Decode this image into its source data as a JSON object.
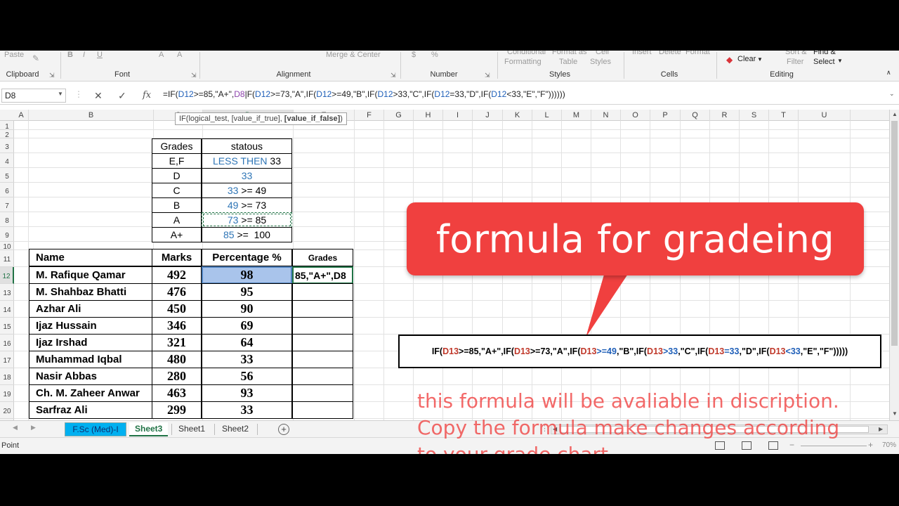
{
  "ribbon": {
    "group_labels": [
      "Clipboard",
      "Font",
      "Alignment",
      "Number",
      "Styles",
      "Cells",
      "Editing"
    ],
    "faded_items": [
      "Paste",
      "B",
      "I",
      "U",
      "A",
      "A",
      "Merge & Center",
      "$",
      "%",
      "Conditional",
      "Formatting",
      "Format as",
      "Table",
      "Cell",
      "Styles",
      "Insert",
      "Delete",
      "Format",
      "Sort &",
      "Filter",
      "Find &",
      "Select"
    ],
    "clear_label": "Clear"
  },
  "formula_bar": {
    "name_box": "D8",
    "cancel_icon": "close-icon",
    "enter_icon": "check-icon",
    "fx_label": "fx",
    "formula_segments": [
      {
        "t": "=IF(",
        "c": ""
      },
      {
        "t": "D12",
        "c": "ref-blue"
      },
      {
        "t": ">=85,\"A+\",",
        "c": ""
      },
      {
        "t": "D8",
        "c": "ref-purple"
      },
      {
        "t": "|F(",
        "c": ""
      },
      {
        "t": "D12",
        "c": "ref-blue"
      },
      {
        "t": ">=73,\"A\",IF(",
        "c": ""
      },
      {
        "t": "D12",
        "c": "ref-blue"
      },
      {
        "t": ">=49,\"B\",IF(",
        "c": ""
      },
      {
        "t": "D12",
        "c": "ref-blue"
      },
      {
        "t": ">33,\"C\",IF(",
        "c": ""
      },
      {
        "t": "D12",
        "c": "ref-blue"
      },
      {
        "t": "=33,\"D\",IF(",
        "c": ""
      },
      {
        "t": "D12",
        "c": "ref-blue"
      },
      {
        "t": "<33,\"E\",\"F\"))))))",
        "c": ""
      }
    ],
    "tooltip_prefix": "IF(logical_test, [value_if_true], ",
    "tooltip_bold": "[value_if_false]",
    "tooltip_suffix": ")"
  },
  "columns": [
    "A",
    "B",
    "C",
    "D",
    "E",
    "F",
    "G",
    "H",
    "I",
    "J",
    "K",
    "L",
    "M",
    "N",
    "O",
    "P",
    "Q",
    "R",
    "S",
    "T",
    "U"
  ],
  "rows": [
    "1",
    "2",
    "3",
    "4",
    "5",
    "6",
    "7",
    "8",
    "9",
    "10",
    "11",
    "12",
    "13",
    "14",
    "15",
    "16",
    "17",
    "18",
    "19",
    "20"
  ],
  "grade_chart": {
    "header_grade": "Grades",
    "header_status": "statous",
    "rows": [
      {
        "grade": "E,F",
        "status_blue": "LESS THEN",
        "status_black": " 33"
      },
      {
        "grade": "D",
        "status_blue": "33",
        "status_black": ""
      },
      {
        "grade": "C",
        "status_blue": "33",
        "status_black": " >= 49"
      },
      {
        "grade": "B",
        "status_blue": "49",
        "status_black": " >= 73"
      },
      {
        "grade": "A",
        "status_blue": "73",
        "status_black": " >= 85"
      },
      {
        "grade": "A+",
        "status_blue": "85",
        "status_black": " >=  100"
      }
    ]
  },
  "students": {
    "headers": [
      "Name",
      "Marks",
      "Percentage %",
      "Grades"
    ],
    "rows": [
      {
        "name": "M. Rafique Qamar",
        "marks": "492",
        "pct": "98",
        "grade": "85,\"A+\",D8"
      },
      {
        "name": "M. Shahbaz Bhatti",
        "marks": "476",
        "pct": "95",
        "grade": ""
      },
      {
        "name": "Azhar Ali",
        "marks": "450",
        "pct": "90",
        "grade": ""
      },
      {
        "name": "Ijaz Hussain",
        "marks": "346",
        "pct": "69",
        "grade": ""
      },
      {
        "name": "Ijaz Irshad",
        "marks": "321",
        "pct": "64",
        "grade": ""
      },
      {
        "name": "Muhammad Iqbal",
        "marks": "480",
        "pct": "33",
        "grade": ""
      },
      {
        "name": "Nasir Abbas",
        "marks": "280",
        "pct": "56",
        "grade": ""
      },
      {
        "name": "Ch. M. Zaheer Anwar",
        "marks": "463",
        "pct": "93",
        "grade": ""
      },
      {
        "name": "Sarfraz Ali",
        "marks": "299",
        "pct": "33",
        "grade": ""
      }
    ]
  },
  "callout": {
    "text": "formula for gradeing",
    "color": "#f0403f"
  },
  "formula_box": {
    "segments": [
      {
        "t": "IF(",
        "c": ""
      },
      {
        "t": "D13",
        "c": "ref-red"
      },
      {
        "t": ">=85,\"A+\",IF(",
        "c": ""
      },
      {
        "t": "D13",
        "c": "ref-red"
      },
      {
        "t": ">=73,\"A\",IF(",
        "c": ""
      },
      {
        "t": "D13",
        "c": "ref-red"
      },
      {
        "t": ">=49",
        "c": "ref-blue"
      },
      {
        "t": ",\"B\",IF(",
        "c": ""
      },
      {
        "t": "D13",
        "c": "ref-red"
      },
      {
        "t": ">33",
        "c": "ref-blue"
      },
      {
        "t": ",\"C\",IF(",
        "c": ""
      },
      {
        "t": "D13",
        "c": "ref-red"
      },
      {
        "t": "=33",
        "c": "ref-blue"
      },
      {
        "t": ",\"D\",IF(",
        "c": ""
      },
      {
        "t": "D13",
        "c": "ref-red"
      },
      {
        "t": "<33",
        "c": "ref-blue"
      },
      {
        "t": ",\"E\",\"F\")))))",
        "c": ""
      }
    ]
  },
  "note": "this formula will be avaliable in discription. Copy the formula make changes according to your grade chart",
  "sheet_tabs": [
    "F.Sc (Med)-I",
    "Sheet3",
    "Sheet1",
    "Sheet2"
  ],
  "active_tab": "Sheet3",
  "status": "Point",
  "zoom": "70%"
}
